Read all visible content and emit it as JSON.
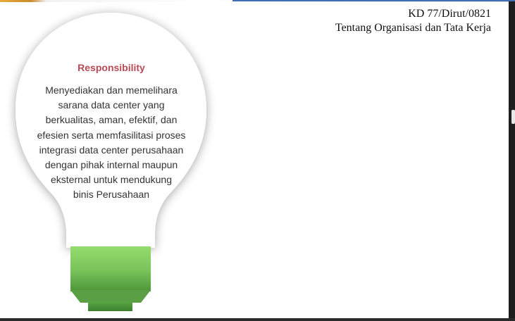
{
  "header": {
    "line1": "KD 77/Dirut/0821",
    "line2": "Tentang Organisasi dan Tata Kerja"
  },
  "bulb": {
    "title": "Responsibility",
    "body_lines": [
      "Menyediakan dan memelihara",
      "sarana data center yang",
      "berkualitas, aman, efektif, dan",
      "efesien serta memfasilitasi proses",
      "integrasi data center perusahaan",
      "dengan pihak internal maupun",
      "eksternal untuk mendukung",
      "binis Perusahaan"
    ]
  },
  "colors": {
    "title_accent": "#b94a55",
    "bulb_base_top": "#8fd86a",
    "bulb_base_bottom": "#4f9a3c"
  }
}
